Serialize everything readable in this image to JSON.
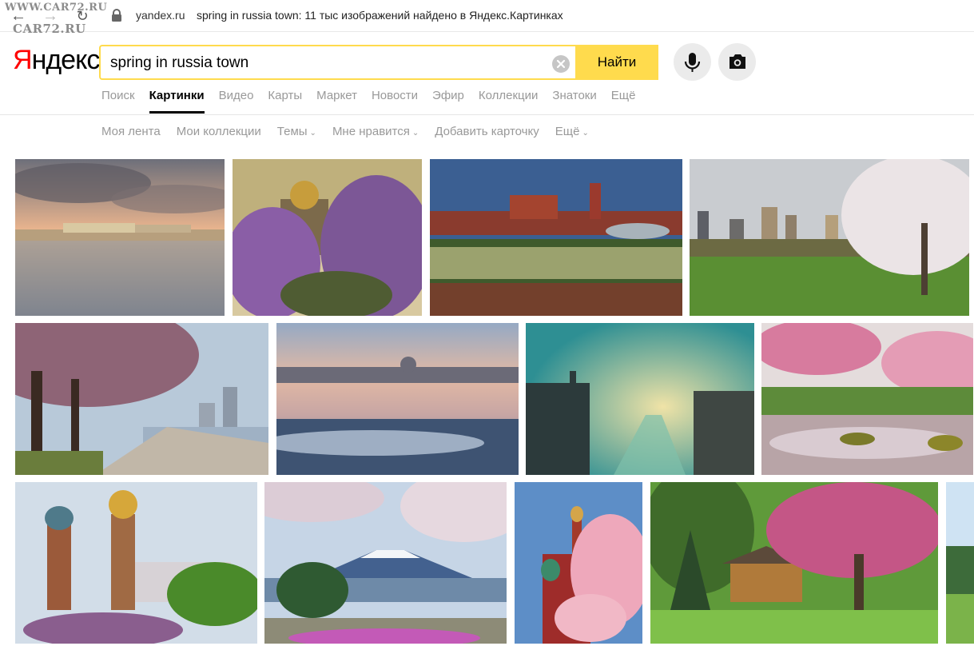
{
  "browser": {
    "watermark_line1": "WWW.CAR72.RU",
    "watermark_line2": "CAR72.RU",
    "url_domain": "yandex.ru",
    "page_title": "spring in russia town: 11 тыс изображений найдено в Яндекс.Картинках"
  },
  "header": {
    "logo_first": "Я",
    "logo_rest": "ндекс",
    "search_value": "spring in russia town",
    "search_button": "Найти"
  },
  "tabs": [
    {
      "label": "Поиск",
      "active": false
    },
    {
      "label": "Картинки",
      "active": true
    },
    {
      "label": "Видео",
      "active": false
    },
    {
      "label": "Карты",
      "active": false
    },
    {
      "label": "Маркет",
      "active": false
    },
    {
      "label": "Новости",
      "active": false
    },
    {
      "label": "Эфир",
      "active": false
    },
    {
      "label": "Коллекции",
      "active": false
    },
    {
      "label": "Знатоки",
      "active": false
    },
    {
      "label": "Ещё",
      "active": false
    }
  ],
  "subnav": [
    {
      "label": "Моя лента",
      "dropdown": false
    },
    {
      "label": "Мои коллекции",
      "dropdown": false
    },
    {
      "label": "Темы",
      "dropdown": true
    },
    {
      "label": "Мне нравится",
      "dropdown": true
    },
    {
      "label": "Добавить карточку",
      "dropdown": false
    },
    {
      "label": "Ещё",
      "dropdown": true
    }
  ],
  "colors": {
    "accent_yellow": "#ffdb4d",
    "logo_red": "#ff0000"
  },
  "images": [
    {
      "name": "neva-embankment-clouds"
    },
    {
      "name": "st-isaacs-cathedral-lilacs"
    },
    {
      "name": "red-square-tulips"
    },
    {
      "name": "city-skyline-blossom-park"
    },
    {
      "name": "blossom-promenade-skyline"
    },
    {
      "name": "winter-palace-river-ice"
    },
    {
      "name": "moscow-river-sunset"
    },
    {
      "name": "pink-blossom-stream"
    },
    {
      "name": "church-of-savior-on-blood"
    },
    {
      "name": "mount-fuji-blossom"
    },
    {
      "name": "st-basils-blossom"
    },
    {
      "name": "covered-bridge-blossom"
    },
    {
      "name": "partial-thumbnail"
    }
  ]
}
